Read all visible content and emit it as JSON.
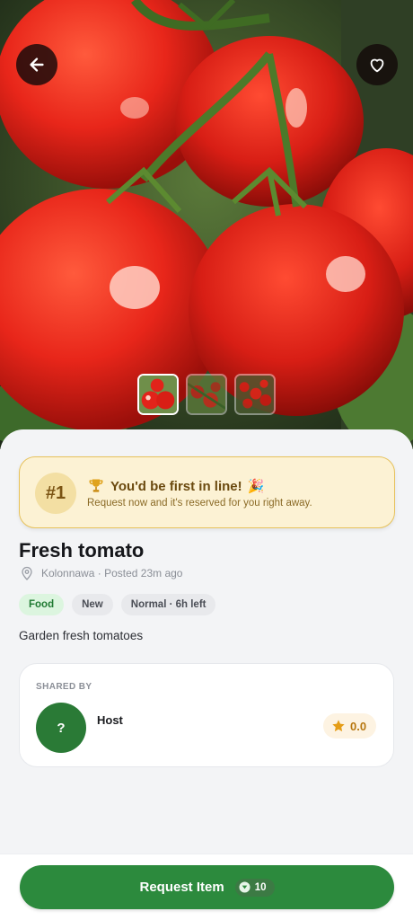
{
  "item": {
    "title": "Fresh tomato",
    "location": "Kolonnawa",
    "separator": "·",
    "posted": "Posted 23m ago",
    "description": "Garden fresh tomatoes"
  },
  "gallery": {
    "image_count": 3,
    "active_index": 0
  },
  "banner": {
    "rank": "#1",
    "title": "You'd be first in line!",
    "subtitle": "Request now and it's reserved for you right away."
  },
  "tags": {
    "category": "Food",
    "condition": "New",
    "urgency": "Normal · 6h left"
  },
  "host": {
    "section_label": "SHARED BY",
    "avatar_initial": "?",
    "name": "Host",
    "rating": "0.0"
  },
  "action": {
    "label": "Request Item",
    "cost": "10"
  },
  "colors": {
    "primary_green": "#2c8a3d",
    "banner_bg": "#fcf2d4",
    "banner_border": "#e7c25c",
    "rating_color": "#b7770f"
  },
  "icons": {
    "back": "arrow-left-icon",
    "favorite": "heart-icon",
    "trophy": "trophy-icon",
    "party": "party-popper-icon",
    "location": "map-pin-icon",
    "star": "star-icon",
    "coin": "coin-icon"
  }
}
